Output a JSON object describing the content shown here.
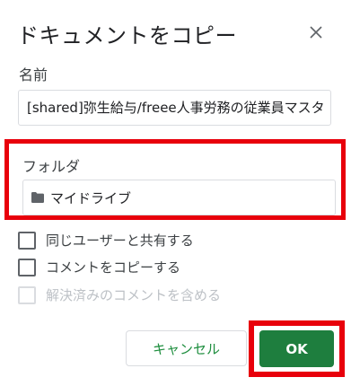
{
  "dialog": {
    "title": "ドキュメントをコピー",
    "close_icon": "close-icon"
  },
  "name_field": {
    "label": "名前",
    "value": "[shared]弥生給与/freee人事労務の従業員マスタ"
  },
  "folder_field": {
    "label": "フォルダ",
    "icon": "folder-icon",
    "value": "マイドライブ"
  },
  "options": [
    {
      "label": "同じユーザーと共有する",
      "checked": false,
      "disabled": false
    },
    {
      "label": "コメントをコピーする",
      "checked": false,
      "disabled": false
    },
    {
      "label": "解決済みのコメントを含める",
      "checked": false,
      "disabled": true
    }
  ],
  "buttons": {
    "cancel_label": "キャンセル",
    "ok_label": "OK"
  },
  "colors": {
    "primary_green": "#1e7e3e",
    "highlight_red": "#e8000b"
  }
}
